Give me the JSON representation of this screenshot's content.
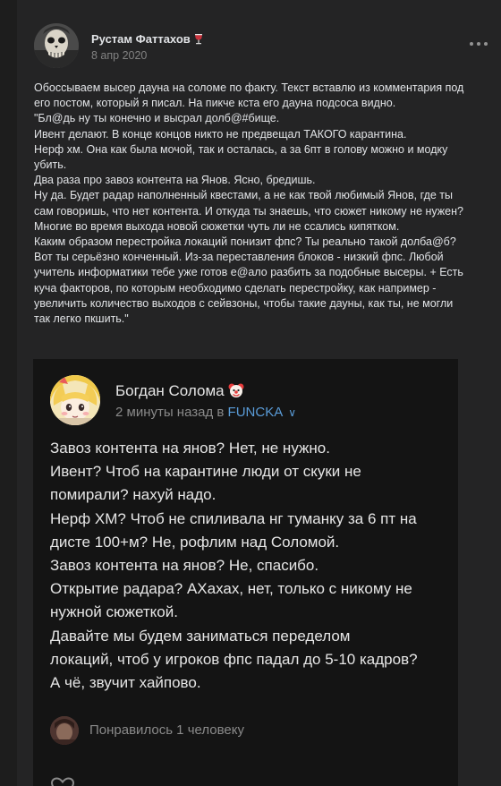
{
  "post": {
    "author": "Рустам Фаттахов",
    "author_badge_icon": "wine-glass-icon",
    "date": "8 апр 2020",
    "menu_icon": "more-dots-icon",
    "text_lines": [
      "Обоссываем высер дауна на соломе по факту. Текст вставлю из комментария под",
      "его постом, который я писал. На пикче кста его дауна подсоса видно.",
      "\"Бл@дь ну ты конечно и высрал долб@#бище.",
      "Ивент делают. В конце концов никто не предвещал ТАКОГО карантина.",
      "Нерф хм. Она как была мочой, так и осталась, а за 6пт в голову можно и модку",
      "убить.",
      "Два раза про завоз контента на Янов. Ясно, бредишь.",
      "Ну да. Будет радар наполненный квестами, а не как твой любимый Янов, где ты",
      "сам говоришь, что нет контента. И откуда ты знаешь, что сюжет никому не нужен?",
      "Многие во время выхода новой сюжетки чуть ли не ссались кипятком.",
      "Каким образом перестройка локаций понизит фпс? Ты реально такой долба@б?",
      "Вот ты серьёзно конченный. Из-за переставления блоков - низкий фпс. Любой",
      "учитель информатики тебе уже готов е@ало разбить за подобные высеры. + Есть",
      "куча факторов, по которым необходимо сделать перестройку, как например -",
      "увеличить количество выходов с сейвзоны, чтобы такие дауны, как ты, не могли",
      "так легко пкшить.\""
    ]
  },
  "screenshot": {
    "author": "Богдан Солома",
    "author_badge_icon": "clown-face-icon",
    "time": "2 минуты назад в",
    "group": "FUNCKA",
    "expand_icon": "chevron-down-icon",
    "text_lines": [
      "Завоз контента на янов? Нет, не нужно.",
      "Ивент? Чтоб на карантине люди от скуки не",
      "помирали? нахуй надо.",
      "Нерф ХМ? Чтоб не спиливала нг туманку за 6 пт на",
      "дисте 100+м? Не, рофлим над Соломой.",
      "Завоз контента на янов? Не, спасибо.",
      "Открытие радара? АХахах, нет, только с никому не",
      "нужной сюжеткой.",
      "Давайте мы будем заниматься переделом",
      "локаций, чтоб у игроков фпс падал до 5-10 кадров?",
      "А чё, звучит хайпово."
    ],
    "likes_text": "Понравилось 1 человеку",
    "like_icon": "heart-outline-icon"
  },
  "colors": {
    "page_background": "#1d1d1d",
    "card_background": "#242425",
    "text_primary": "#e1e3e6",
    "text_secondary": "#828282",
    "screenshot_background": "#141414",
    "link_blue": "#5a9cd8"
  }
}
